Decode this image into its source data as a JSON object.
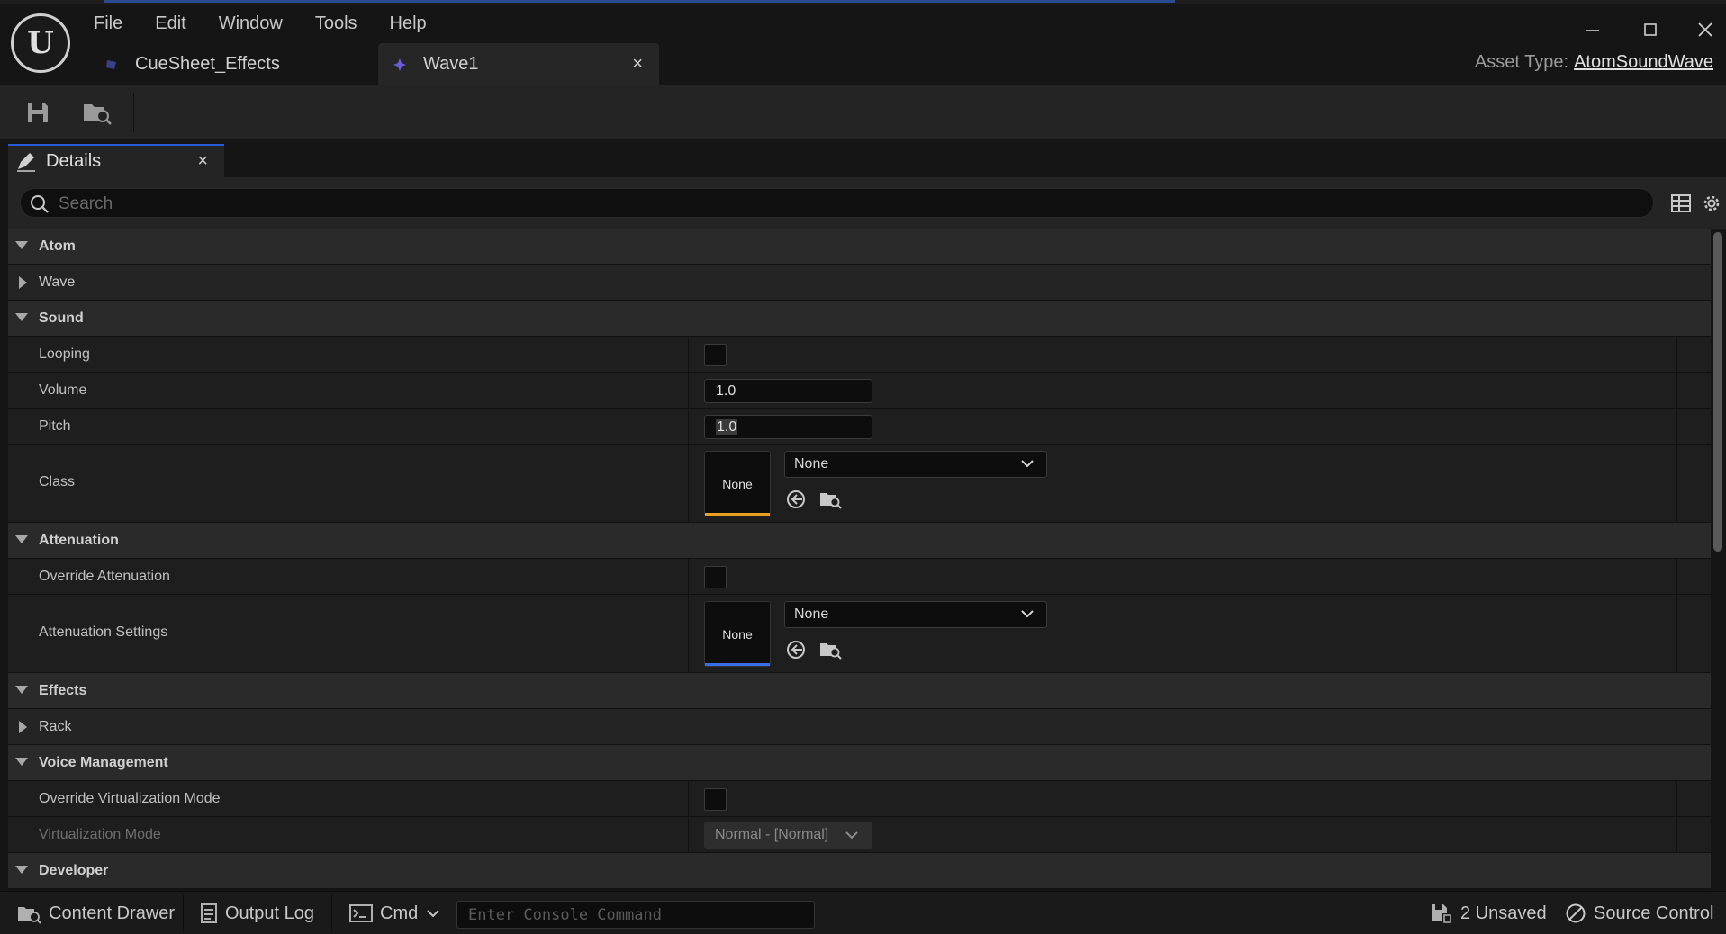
{
  "menu": [
    "File",
    "Edit",
    "Window",
    "Tools",
    "Help"
  ],
  "tabs": [
    {
      "label": "CueSheet_Effects",
      "active": false
    },
    {
      "label": "Wave1",
      "active": true,
      "close": "×"
    }
  ],
  "asset_type": {
    "label": "Asset Type:",
    "value": "AtomSoundWave"
  },
  "details": {
    "tab_label": "Details",
    "close": "×",
    "search_placeholder": "Search"
  },
  "properties": {
    "atom": "Atom",
    "wave": "Wave",
    "sound": "Sound",
    "looping": "Looping",
    "volume": {
      "label": "Volume",
      "value": "1.0"
    },
    "pitch": {
      "label": "Pitch",
      "value": "1.0"
    },
    "class": {
      "label": "Class",
      "thumb": "None",
      "combo": "None"
    },
    "attenuation": "Attenuation",
    "override_attenuation": "Override Attenuation",
    "attenuation_settings": {
      "label": "Attenuation Settings",
      "thumb": "None",
      "combo": "None"
    },
    "effects": "Effects",
    "rack": "Rack",
    "voice_management": "Voice Management",
    "override_virtualization": "Override Virtualization Mode",
    "virtualization_mode": {
      "label": "Virtualization Mode",
      "value": "Normal - [Normal]"
    },
    "developer": "Developer"
  },
  "statusbar": {
    "content_drawer": "Content Drawer",
    "output_log": "Output Log",
    "cmd": "Cmd",
    "console_placeholder": "Enter Console Command",
    "unsaved": "2 Unsaved",
    "source_control": "Source Control"
  },
  "colors": {
    "class_accent": "#e8a020",
    "attenuation_accent": "#3a6ee8",
    "tab_accent": "#2a5bd7"
  }
}
